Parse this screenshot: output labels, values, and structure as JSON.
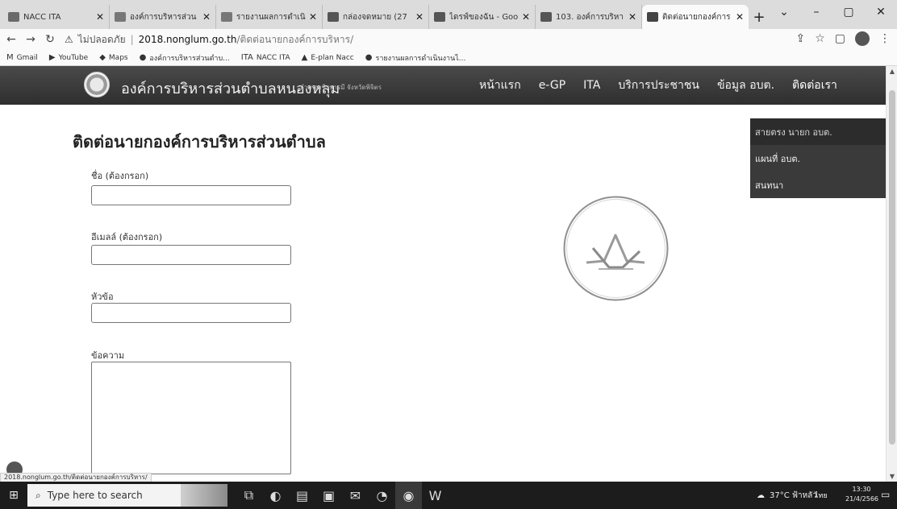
{
  "browser": {
    "tabs": [
      {
        "title": "NACC ITA",
        "favicon_color": "#6a6a6a"
      },
      {
        "title": "องค์การบริหารส่วน",
        "favicon_color": "#777777"
      },
      {
        "title": "รายงานผลการดำเนิ",
        "favicon_color": "#777777"
      },
      {
        "title": "กล่องจดหมาย (27",
        "favicon_color": "#555555"
      },
      {
        "title": "ไดรฟ์ของฉัน - Goo",
        "favicon_color": "#555555"
      },
      {
        "title": "103. องค์การบริหา",
        "favicon_color": "#555555"
      },
      {
        "title": "ติดต่อนายกองค์การ",
        "favicon_color": "#444444"
      }
    ],
    "new_tab_label": "+",
    "window_controls": {
      "collapse": "⌄",
      "minimize": "–",
      "maximize": "▢",
      "close": "✕"
    },
    "address": {
      "security_label": "ไม่ปลอดภัย",
      "separator": "|",
      "domain": "2018.nonglum.go.th",
      "path": "/ติดต่อนายกองค์การบริหาร/"
    },
    "bookmarks": [
      {
        "icon": "M",
        "label": "Gmail"
      },
      {
        "icon": "▶",
        "label": "YouTube"
      },
      {
        "icon": "◆",
        "label": "Maps"
      },
      {
        "icon": "●",
        "label": "องค์การบริหารส่วนตำบ..."
      },
      {
        "icon": "ITA",
        "label": "NACC ITA"
      },
      {
        "icon": "▲",
        "label": "E-plan Nacc"
      },
      {
        "icon": "●",
        "label": "รายงานผลการดำเนินงานไ..."
      }
    ]
  },
  "site": {
    "title": "องค์การบริหารส่วนตำบลหนองหลุม",
    "subtitle": "อำเภอวชิรบารมี จังหวัดพิจิตร",
    "nav": [
      {
        "label": "หน้าแรก"
      },
      {
        "label": "e-GP"
      },
      {
        "label": "ITA"
      },
      {
        "label": "บริการประชาชน"
      },
      {
        "label": "ข้อมูล อบต."
      },
      {
        "label": "ติดต่อเรา"
      }
    ],
    "dropdown": [
      {
        "label": "สายตรง นายก อบต."
      },
      {
        "label": "แผนที่ อบต."
      },
      {
        "label": "สนทนา"
      }
    ]
  },
  "form": {
    "page_title": "ติดต่อนายกองค์การบริหารส่วนตำบล",
    "name_label": "ชื่อ (ต้องกรอก)",
    "name_value": "",
    "email_label": "อีเมลล์ (ต้องกรอก)",
    "email_value": "",
    "subject_label": "หัวข้อ",
    "subject_value": "",
    "message_label": "ข้อความ",
    "message_value": ""
  },
  "status_url": "2018.nonglum.go.th/ติดต่อนายกองค์การบริหาร/",
  "taskbar": {
    "search_placeholder": "Type here to search",
    "weather": "37°C ฟ้าหลัว",
    "language": "ไทย",
    "time": "13:30",
    "date": "21/4/2566"
  },
  "colors": {
    "header_bg": "#3a3a3a",
    "dropdown_bg": "#3a3a3a",
    "taskbar_bg": "#1c1c1c"
  }
}
